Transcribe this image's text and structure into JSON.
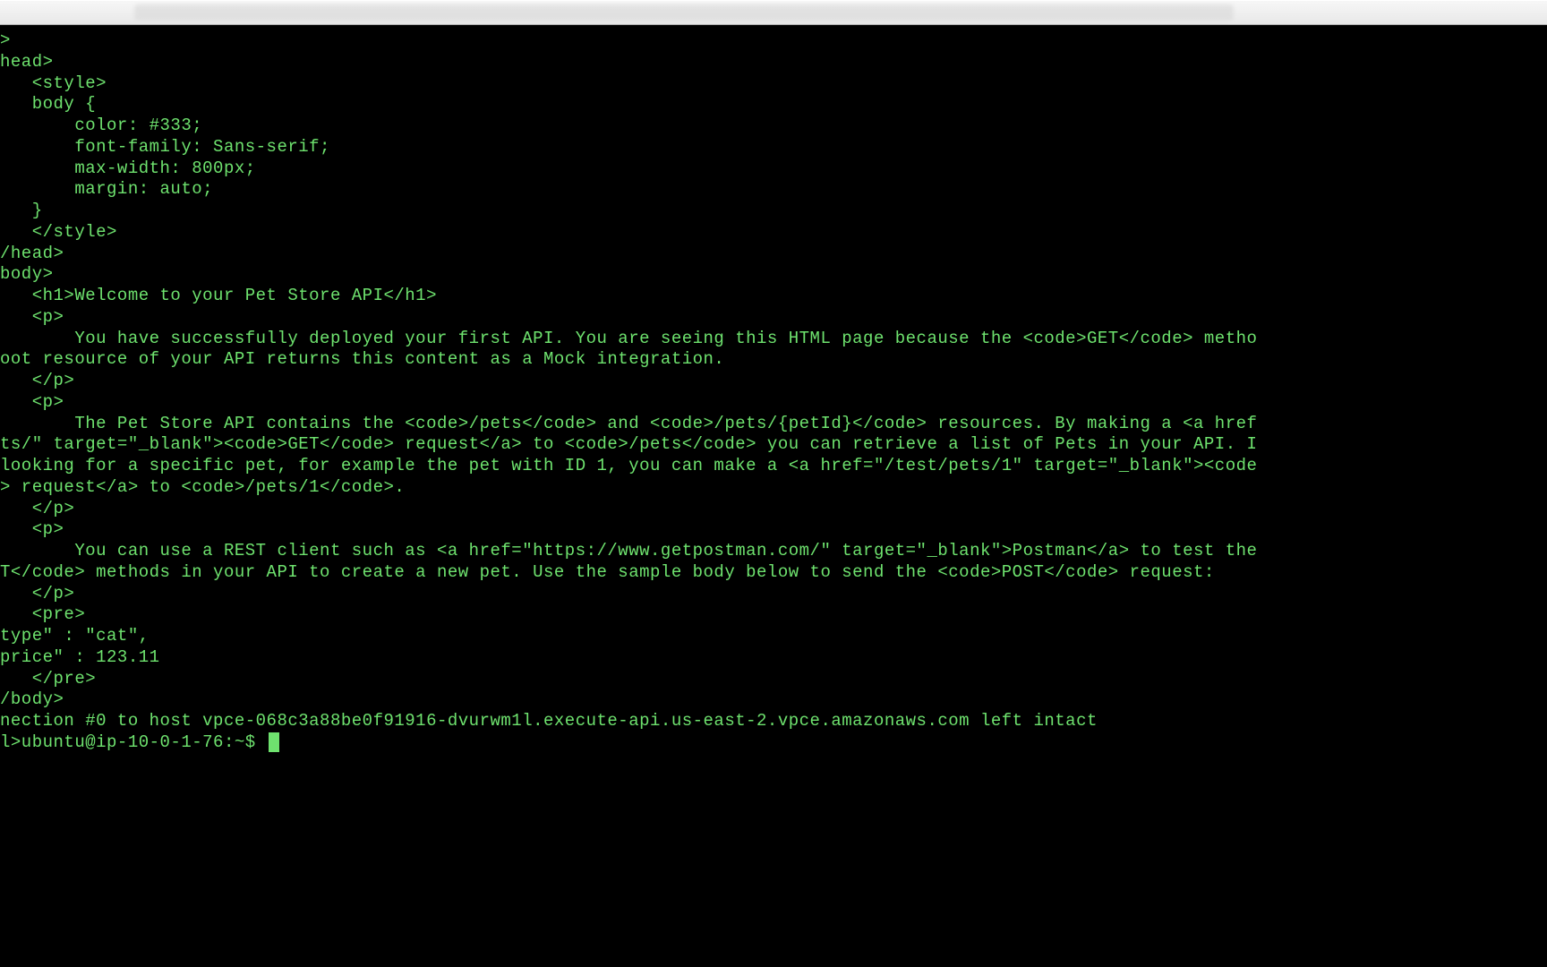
{
  "terminal": {
    "lines": [
      ">",
      "head>",
      "   <style>",
      "   body {",
      "       color: #333;",
      "       font-family: Sans-serif;",
      "       max-width: 800px;",
      "       margin: auto;",
      "   }",
      "   </style>",
      "/head>",
      "body>",
      "   <h1>Welcome to your Pet Store API</h1>",
      "   <p>",
      "       You have successfully deployed your first API. You are seeing this HTML page because the <code>GET</code> metho",
      "oot resource of your API returns this content as a Mock integration.",
      "   </p>",
      "   <p>",
      "       The Pet Store API contains the <code>/pets</code> and <code>/pets/{petId}</code> resources. By making a <a href",
      "ts/\" target=\"_blank\"><code>GET</code> request</a> to <code>/pets</code> you can retrieve a list of Pets in your API. I",
      "looking for a specific pet, for example the pet with ID 1, you can make a <a href=\"/test/pets/1\" target=\"_blank\"><code",
      "> request</a> to <code>/pets/1</code>.",
      "   </p>",
      "   <p>",
      "       You can use a REST client such as <a href=\"https://www.getpostman.com/\" target=\"_blank\">Postman</a> to test the",
      "T</code> methods in your API to create a new pet. Use the sample body below to send the <code>POST</code> request:",
      "   </p>",
      "   <pre>",
      "",
      "type\" : \"cat\",",
      "price\" : 123.11",
      "",
      "   </pre>",
      "/body>",
      "nection #0 to host vpce-068c3a88be0f91916-dvurwm1l.execute-api.us-east-2.vpce.amazonaws.com left intact"
    ],
    "prompt": "l>ubuntu@ip-10-0-1-76:~$ "
  }
}
